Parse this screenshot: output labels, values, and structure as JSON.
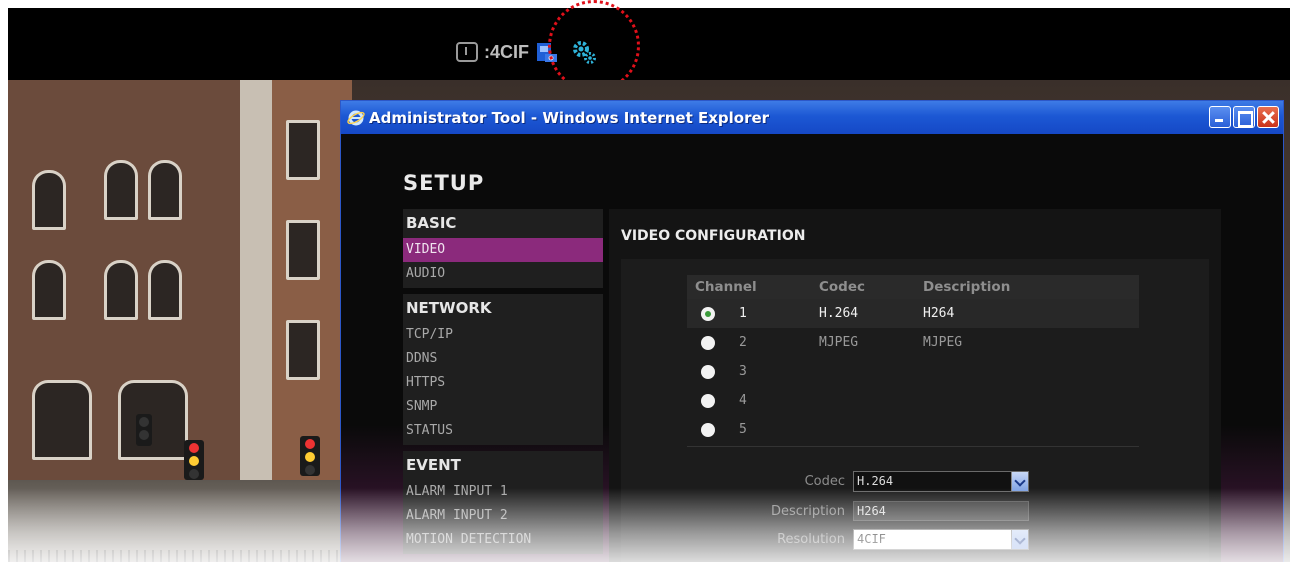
{
  "toolbar": {
    "resolution_label": ":4CIF",
    "icons": [
      "resolution-icon",
      "camera-icon",
      "settings-gear-icon"
    ],
    "highlight_color": "#e0101a"
  },
  "window": {
    "title": "Administrator Tool - Windows Internet Explorer",
    "controls": [
      "minimize",
      "maximize",
      "close"
    ]
  },
  "setup": {
    "title": "SETUP",
    "sections": [
      {
        "header": "BASIC",
        "items": [
          "VIDEO",
          "AUDIO"
        ]
      },
      {
        "header": "NETWORK",
        "items": [
          "TCP/IP",
          "DDNS",
          "HTTPS",
          "SNMP",
          "STATUS"
        ]
      },
      {
        "header": "EVENT",
        "items": [
          "ALARM INPUT 1",
          "ALARM INPUT 2",
          "MOTION DETECTION"
        ]
      }
    ],
    "active_item": "VIDEO",
    "accent_color": "#8b2a7c"
  },
  "video_config": {
    "title": "VIDEO CONFIGURATION",
    "columns": [
      "Channel",
      "Codec",
      "Description"
    ],
    "rows": [
      {
        "channel": "1",
        "codec": "H.264",
        "description": "H264",
        "selected": true
      },
      {
        "channel": "2",
        "codec": "MJPEG",
        "description": "MJPEG",
        "selected": false
      },
      {
        "channel": "3",
        "codec": "",
        "description": "",
        "selected": false
      },
      {
        "channel": "4",
        "codec": "",
        "description": "",
        "selected": false
      },
      {
        "channel": "5",
        "codec": "",
        "description": "",
        "selected": false
      }
    ],
    "form": {
      "codec_label": "Codec",
      "codec_value": "H.264",
      "description_label": "Description",
      "description_value": "H264",
      "resolution_label": "Resolution",
      "resolution_value": "4CIF"
    }
  }
}
